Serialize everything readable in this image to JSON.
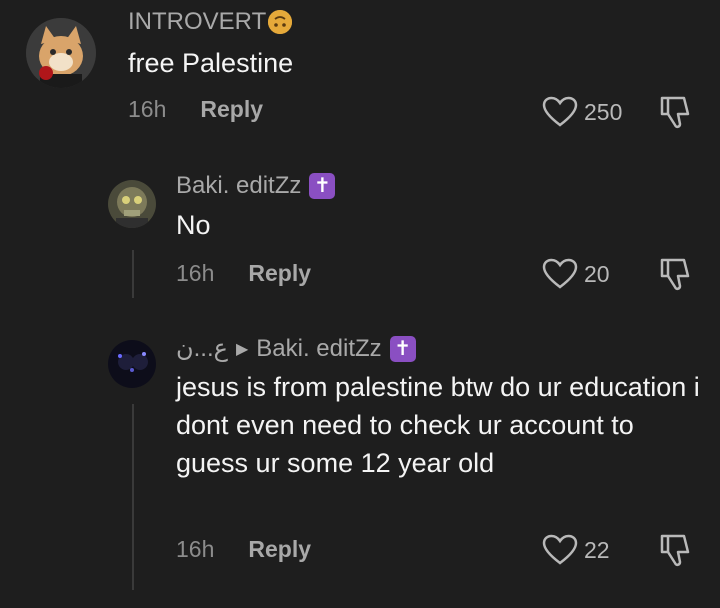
{
  "comments": [
    {
      "username": "INTROVERT",
      "text": "free Palestine",
      "time": "16h",
      "reply_label": "Reply",
      "likes": "250"
    },
    {
      "username": "Baki. editZz",
      "badge": "✝",
      "text": "No",
      "time": "16h",
      "reply_label": "Reply",
      "likes": "20"
    },
    {
      "username": "ع...ن",
      "reply_to": "Baki. editZz",
      "badge": "✝",
      "text": "jesus is from palestine btw do ur education i dont even need to check ur account to guess ur some 12 year old",
      "time": "16h",
      "reply_label": "Reply",
      "likes": "22"
    }
  ],
  "icons": {
    "like": "heart-outline-icon",
    "dislike": "thumbs-down-icon",
    "reply_arrow": "triangle-right-icon"
  },
  "colors": {
    "background": "#1e1e1e",
    "badge": "#8a4fc2"
  }
}
